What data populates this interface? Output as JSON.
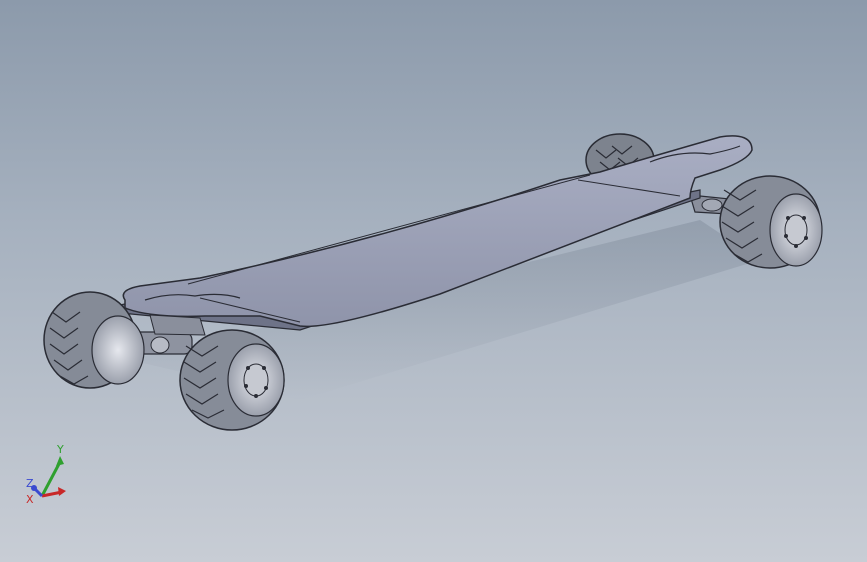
{
  "viewport": {
    "background_top": "#8c9aab",
    "background_bottom": "#c8cdd5"
  },
  "model": {
    "deck_color": "#9aa0b6",
    "wheel_color": "#8c929e",
    "edge_color": "#2a2c35"
  },
  "triad": {
    "y_label": "Y",
    "z_label": "Z",
    "x_label": "X",
    "y_color": "#2fa02f",
    "z_color": "#3a4ad0",
    "x_color": "#c82828"
  }
}
